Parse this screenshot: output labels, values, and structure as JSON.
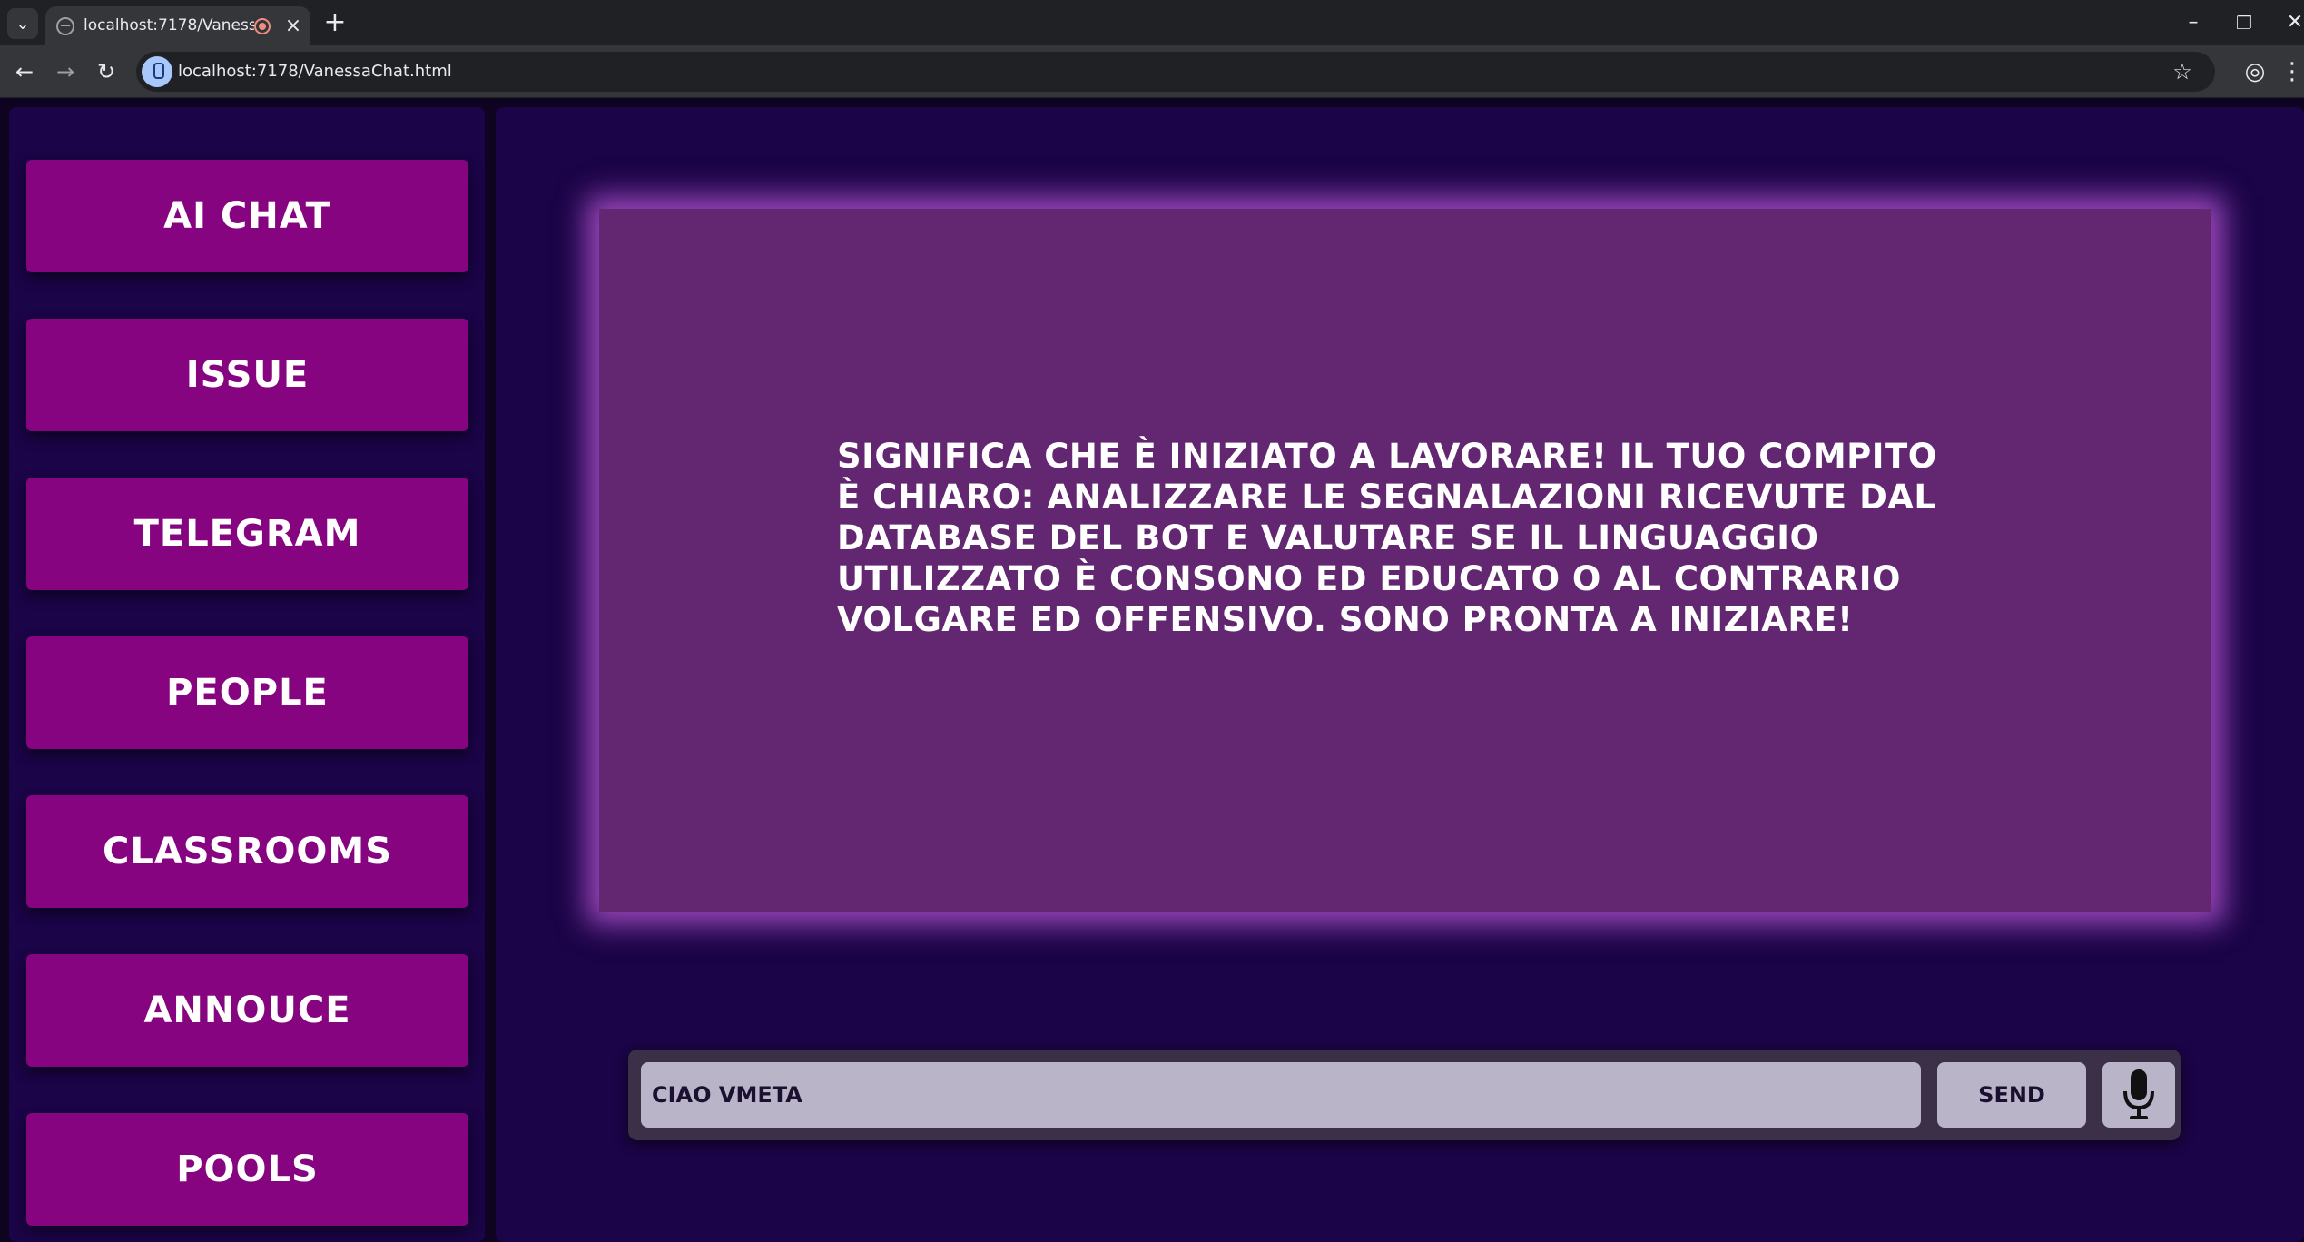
{
  "browser": {
    "tab_title": "localhost:7178/VanessaChat.html",
    "url": "localhost:7178/VanessaChat.html",
    "icons": {
      "tab_list": "chevron-down-icon",
      "favicon": "globe-icon",
      "recording": "recording-icon",
      "close_tab": "close-icon",
      "new_tab": "plus-icon",
      "back": "arrow-left-icon",
      "forward": "arrow-right-icon",
      "reload": "reload-icon",
      "site_info": "microphone-indicator-icon",
      "bookmark": "star-icon",
      "profile": "profile-icon",
      "menu": "kebab-menu-icon"
    }
  },
  "sidebar": {
    "items": [
      {
        "label": "AI CHAT"
      },
      {
        "label": "ISSUE"
      },
      {
        "label": "TELEGRAM"
      },
      {
        "label": "PEOPLE"
      },
      {
        "label": "CLASSROOMS"
      },
      {
        "label": "ANNOUCE"
      },
      {
        "label": "POOLS"
      }
    ]
  },
  "chat": {
    "response": "Significa che è iniziato a lavorare! Il tuo compito è chiaro: analizzare le segnalazioni ricevute dal database del bot e valutare se il linguaggio utilizzato è consono ed educato o al contrario volgare ed offensivo. Sono pronta a iniziare!",
    "input_value": "CIAO VMETA",
    "send_label": "SEND",
    "mic_icon": "microphone-icon"
  },
  "colors": {
    "nav_button": "#86047f",
    "panel_bg": "#1b0447",
    "card_bg": "#632772",
    "card_glow": "#b054ce",
    "input_bg": "#bab4c9"
  }
}
